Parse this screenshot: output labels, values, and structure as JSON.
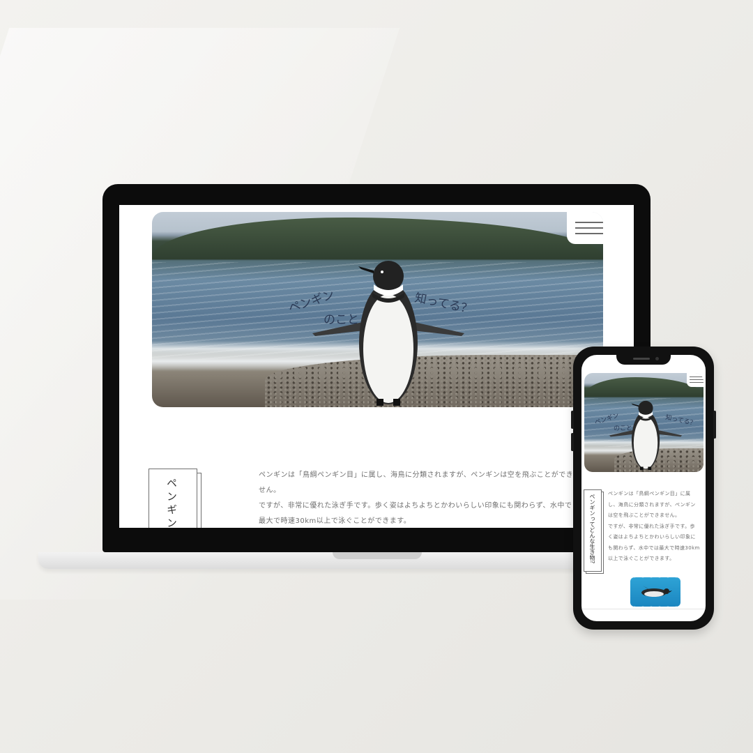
{
  "hero": {
    "title_line1": "ペンギン",
    "title_line2": "のこと",
    "title_line3": "知ってる？"
  },
  "section": {
    "vertical_heading_desktop": "ペンギンっ",
    "vertical_heading_mobile": "ペンギンってどんな生き物?",
    "desktop_lines": [
      "ペンギンは「鳥綱ペンギン目」に属し、海鳥に分類されますが、ペンギンは空を飛ぶことができ",
      "せん。",
      "ですが、非常に優れた泳ぎ手です。歩く姿はよちよちとかわいらしい印象にも関わらず、水中で",
      "最大で時速30km以上で泳ぐことができます。"
    ],
    "mobile_lines": [
      "ペンギンは「鳥綱ペンギン目」に属",
      "し、海鳥に分類されますが、ペンギン",
      "は空を飛ぶことができません。",
      "ですが、非常に優れた泳ぎ手です。歩",
      "く姿はよちよちとかわいらしい印象に",
      "も関わらず、水中では最大で時速30km",
      "以上で泳ぐことができます。"
    ]
  },
  "icons": {
    "menu": "hamburger-menu-icon",
    "penguin": "penguin-icon"
  },
  "colors": {
    "text": "#6f6f6f",
    "heading": "#333333",
    "title": "#2b3a55",
    "bezel": "#0c0c0c",
    "thumb": "#2ea3d6"
  }
}
